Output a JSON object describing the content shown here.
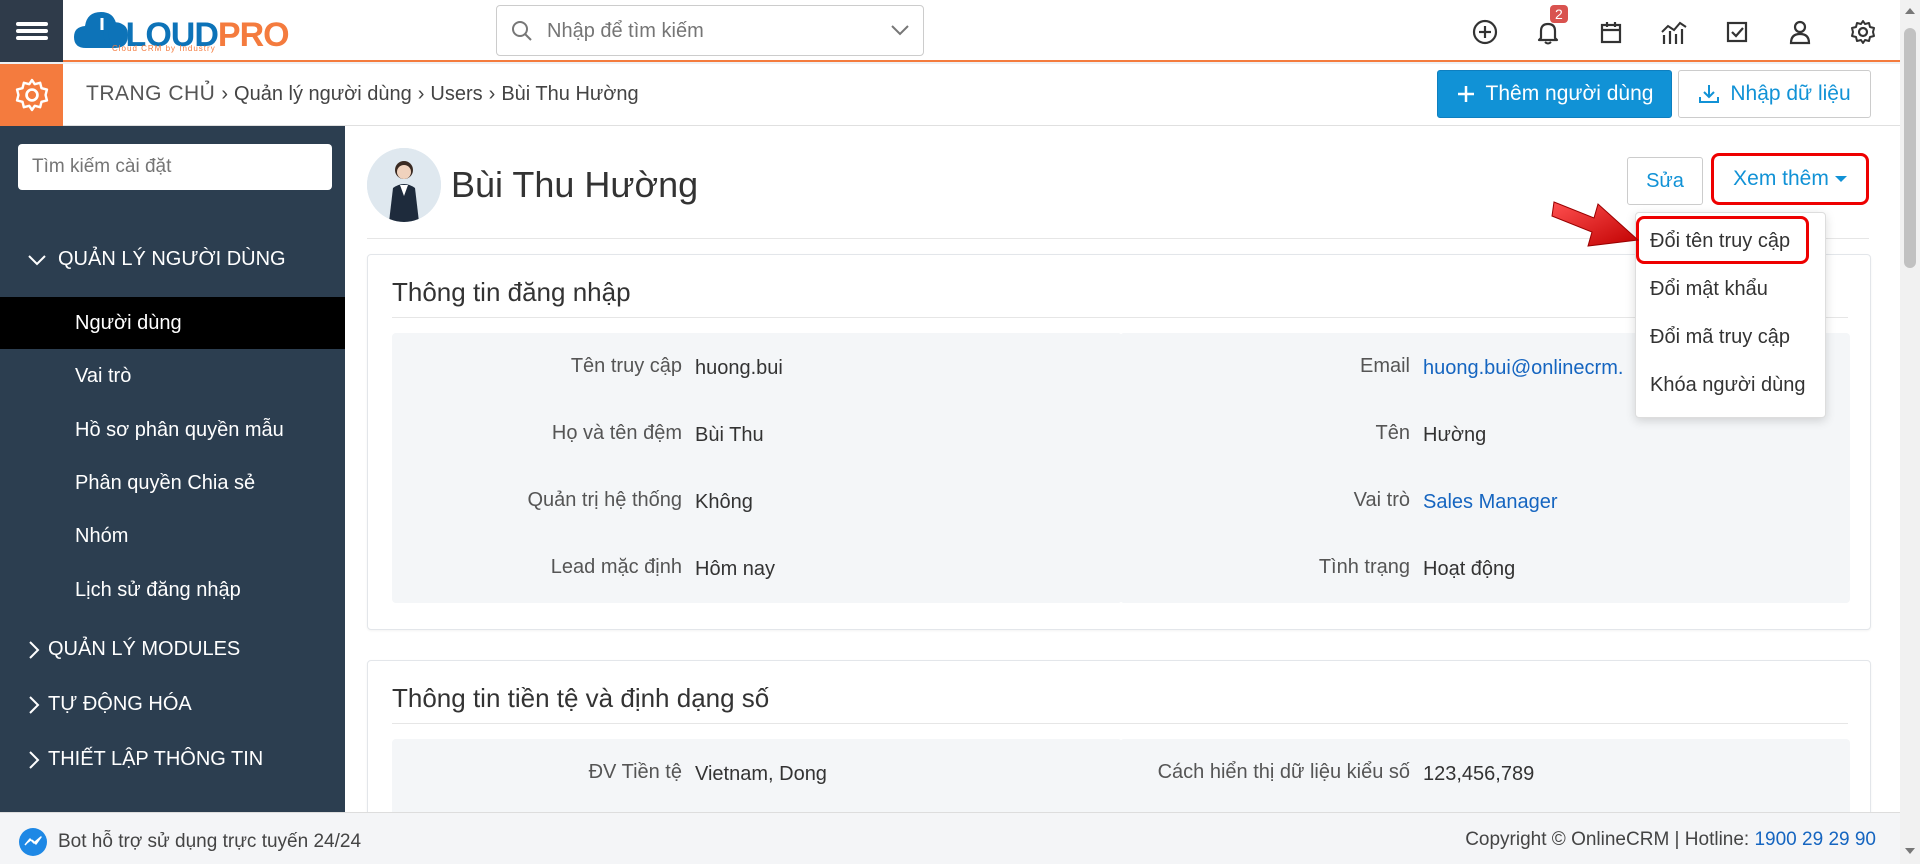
{
  "app": {
    "logo_main": "CLOUD",
    "logo_accent": "PRO",
    "logo_tagline": "Cloud CRM by Industry"
  },
  "search": {
    "placeholder": "Nhập để tìm kiếm"
  },
  "topbar": {
    "notification_count": "2",
    "icons": [
      "plus-circle-icon",
      "bell-icon",
      "calendar-icon",
      "chart-icon",
      "checkbox-icon",
      "user-icon",
      "gear-icon"
    ]
  },
  "breadcrumb": {
    "home": "TRANG CHỦ",
    "items": [
      "Quản lý người dùng",
      "Users",
      "Bùi Thu Hường"
    ]
  },
  "actions": {
    "add_user": "Thêm người dùng",
    "import": "Nhập dữ liệu"
  },
  "sidebar": {
    "search_placeholder": "Tìm kiếm cài đặt",
    "section_user": "QUẢN LÝ NGƯỜI DÙNG",
    "items": [
      "Người dùng",
      "Vai trò",
      "Hồ sơ phân quyền mẫu",
      "Phân quyền Chia sẻ",
      "Nhóm",
      "Lịch sử đăng nhập"
    ],
    "sections": [
      "QUẢN LÝ MODULES",
      "TỰ ĐỘNG HÓA",
      "THIẾT LẬP THÔNG TIN"
    ]
  },
  "user": {
    "name": "Bùi Thu Hường",
    "edit": "Sửa",
    "more": "Xem thêm"
  },
  "dropdown": {
    "items": [
      "Đổi tên truy cập",
      "Đổi mật khẩu",
      "Đổi mã truy cập",
      "Khóa người dùng"
    ]
  },
  "login_info": {
    "title": "Thông tin đăng nhập",
    "left": [
      {
        "label": "Tên truy cập",
        "value": "huong.bui"
      },
      {
        "label": "Họ và tên đệm",
        "value": "Bùi Thu"
      },
      {
        "label": "Quản trị hệ thống",
        "value": "Không"
      },
      {
        "label": "Lead mặc định",
        "value": "Hôm nay"
      }
    ],
    "right": [
      {
        "label": "Email",
        "value": "huong.bui@onlinecrm."
      },
      {
        "label": "Tên",
        "value": "Hường"
      },
      {
        "label": "Vai trò",
        "value": "Sales Manager"
      },
      {
        "label": "Tình trạng",
        "value": "Hoạt động"
      }
    ]
  },
  "currency_info": {
    "title": "Thông tin tiền tệ và định dạng số",
    "left_label": "ĐV Tiền tệ",
    "left_value": "Vietnam, Dong",
    "right_label": "Cách hiển thị dữ liệu kiểu số",
    "right_value": "123,456,789"
  },
  "footer": {
    "bot": "Bot hỗ trợ sử dụng trực tuyến 24/24",
    "copyright": "Copyright © OnlineCRM",
    "hotline_label": "Hotline:",
    "hotline": "1900 29 29 90"
  },
  "colors": {
    "brand_blue": "#1192d6",
    "brand_orange": "#f47b3e",
    "sidebar": "#2c3e50",
    "highlight": "#ee0000"
  }
}
